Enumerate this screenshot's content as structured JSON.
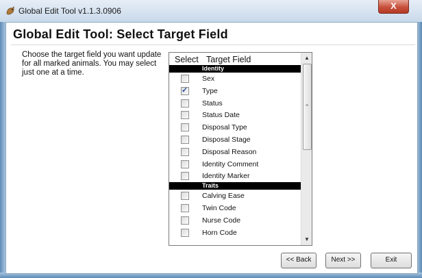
{
  "window": {
    "title": "Global Edit Tool v1.1.3.0906",
    "close_label": "X"
  },
  "page": {
    "title": "Global Edit Tool:  Select Target Field",
    "instructions": "Choose the target field you want update for all marked animals.  You may select just one at a time."
  },
  "list": {
    "headers": {
      "select": "Select",
      "field": "Target Field"
    },
    "rows": [
      {
        "type": "group",
        "label": "Identity"
      },
      {
        "type": "item",
        "label": "Sex",
        "checked": false
      },
      {
        "type": "item",
        "label": "Type",
        "checked": true
      },
      {
        "type": "item",
        "label": "Status",
        "checked": false
      },
      {
        "type": "item",
        "label": "Status Date",
        "checked": false
      },
      {
        "type": "item",
        "label": "Disposal Type",
        "checked": false
      },
      {
        "type": "item",
        "label": "Disposal Stage",
        "checked": false
      },
      {
        "type": "item",
        "label": "Disposal Reason",
        "checked": false
      },
      {
        "type": "item",
        "label": "Identity Comment",
        "checked": false
      },
      {
        "type": "item",
        "label": "Identity Marker",
        "checked": false
      },
      {
        "type": "group",
        "label": "Traits"
      },
      {
        "type": "item",
        "label": "Calving Ease",
        "checked": false
      },
      {
        "type": "item",
        "label": "Twin Code",
        "checked": false
      },
      {
        "type": "item",
        "label": "Nurse Code",
        "checked": false
      },
      {
        "type": "item",
        "label": "Horn Code",
        "checked": false
      }
    ],
    "scroll": {
      "up_arrow": "▲",
      "down_arrow": "▼",
      "grip": "≡"
    }
  },
  "buttons": {
    "back": "<< Back",
    "next": "Next >>",
    "exit": "Exit"
  }
}
